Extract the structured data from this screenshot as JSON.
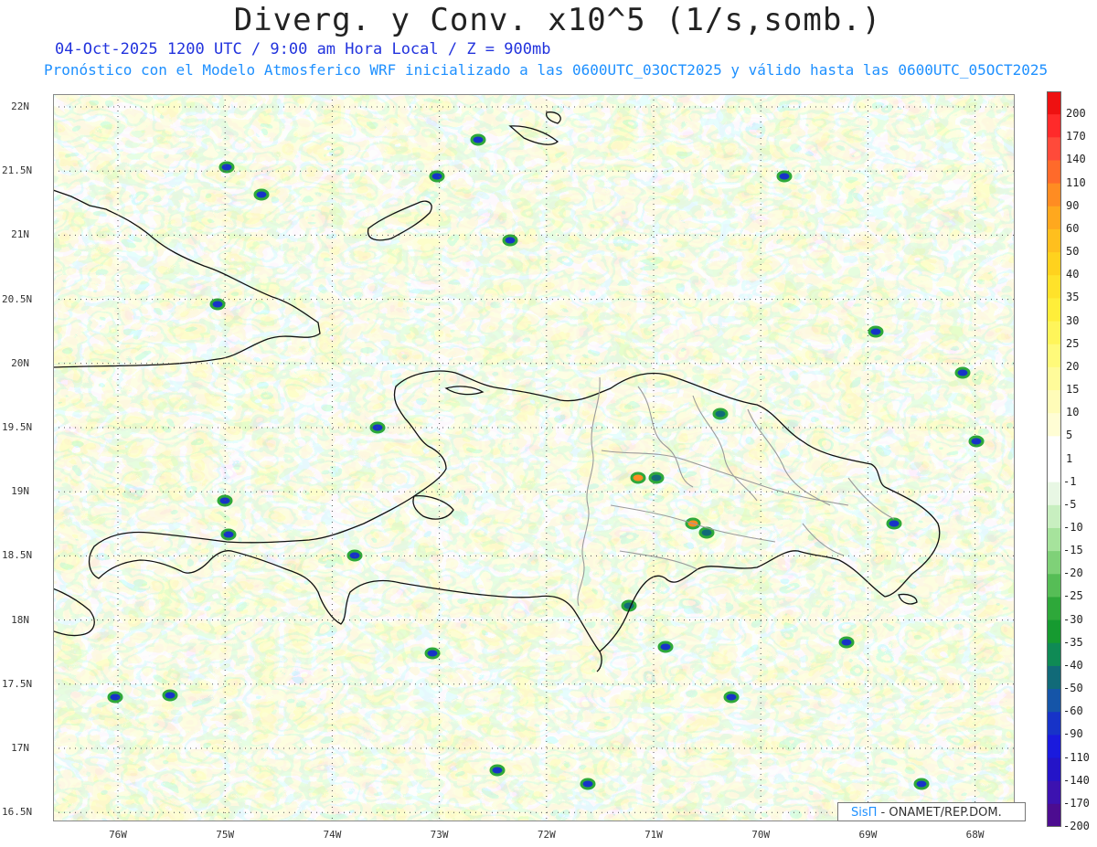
{
  "header": {
    "title": "Diverg. y Conv. x10^5 (1/s,somb.)",
    "subtitle": "04-Oct-2025  1200 UTC / 9:00 am Hora Local / Z = 900mb",
    "subtitle2": "Pronóstico con el Modelo Atmosferico WRF inicializado a las 0600UTC_03OCT2025 y válido hasta las  0600UTC_05OCT2025"
  },
  "axes": {
    "y_labels": [
      "22N",
      "21.5N",
      "21N",
      "20.5N",
      "20N",
      "19.5N",
      "19N",
      "18.5N",
      "18N",
      "17.5N",
      "17N",
      "16.5N"
    ],
    "x_labels": [
      "76W",
      "75W",
      "74W",
      "73W",
      "72W",
      "71W",
      "70W",
      "69W",
      "68W"
    ]
  },
  "colorbar": {
    "labels": [
      "200",
      "170",
      "140",
      "110",
      "90",
      "60",
      "50",
      "40",
      "35",
      "30",
      "25",
      "20",
      "15",
      "10",
      "5",
      "1",
      "-1",
      "-5",
      "-10",
      "-15",
      "-20",
      "-25",
      "-30",
      "-35",
      "-40",
      "-50",
      "-60",
      "-90",
      "-110",
      "-140",
      "-170",
      "-200"
    ],
    "colors": [
      "#ee1111",
      "#ff2a2a",
      "#ff4a3a",
      "#ff6a2a",
      "#ff8c22",
      "#ffa81e",
      "#ffbf1e",
      "#ffd21e",
      "#ffe22a",
      "#ffee3a",
      "#fff55a",
      "#fffa7a",
      "#fffb9a",
      "#fffcb8",
      "#fffdd4",
      "#ffffff",
      "#ffffff",
      "#e8f7e4",
      "#c8efc0",
      "#a6e39c",
      "#7fd178",
      "#56bd56",
      "#2ea83a",
      "#169a30",
      "#0f8a55",
      "#116a78",
      "#1555a8",
      "#1733c8",
      "#1a1add",
      "#2414c8",
      "#3c12b0",
      "#4c0c90"
    ]
  },
  "credit": {
    "brand": "SisΠ",
    "text": " - ONAMET/REP.DOM."
  }
}
